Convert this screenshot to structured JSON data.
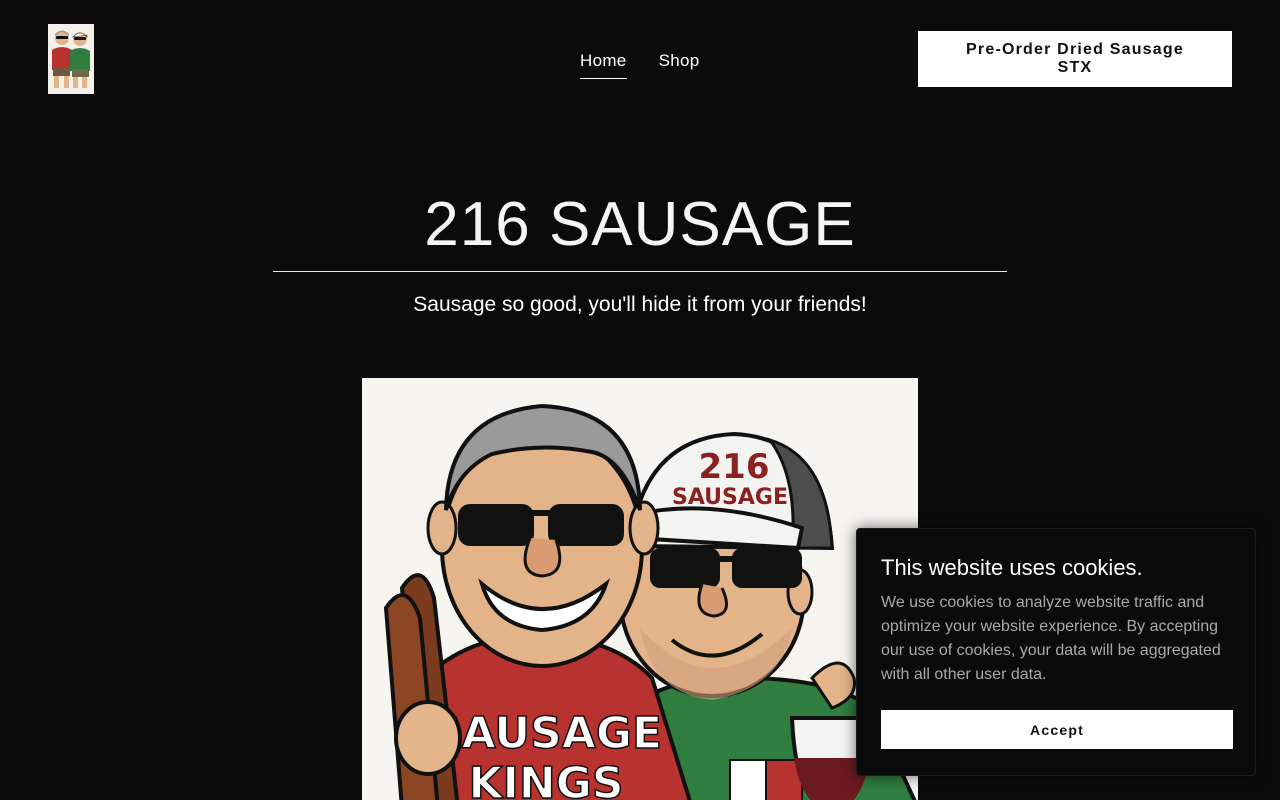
{
  "header": {
    "logo_icon": "caricature-logo",
    "nav": [
      {
        "label": "Home",
        "active": true
      },
      {
        "label": "Shop",
        "active": false
      }
    ],
    "cta_label": "Pre-Order Dried Sausage STX"
  },
  "hero": {
    "title": "216 SAUSAGE",
    "tagline": "Sausage so good, you'll hide it from your friends!",
    "image": {
      "icon": "caricature-illustration",
      "cap_line1": "216",
      "cap_line2": "SAUSAGE",
      "shirt_line1": "SAUSAGE",
      "shirt_line2": "KINGS"
    }
  },
  "cookie_banner": {
    "title": "This website uses cookies.",
    "body": "We use cookies to analyze website traffic and optimize your website experience. By accepting our use of cookies, your data will be aggregated with all other user data.",
    "accept_label": "Accept"
  },
  "colors": {
    "background": "#0b0b0b",
    "text": "#ffffff",
    "button_bg": "#ffffff",
    "button_text": "#111111",
    "muted_text": "#a9a9a9",
    "shirt_red": "#b8322f",
    "shirt_green": "#2f7d3f",
    "cap_text": "#8a2222"
  }
}
